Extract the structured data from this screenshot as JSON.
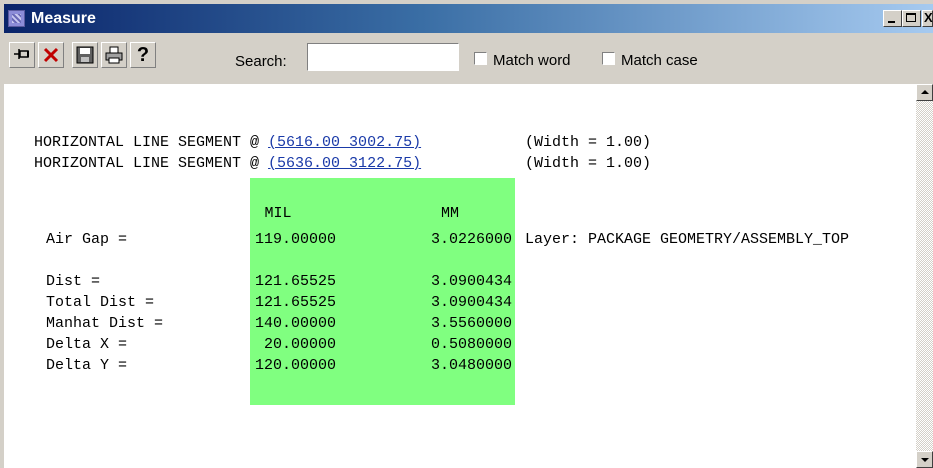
{
  "window": {
    "title": "Measure",
    "minimize_icon": "minimize-icon",
    "maximize_icon": "maximize-icon",
    "close_glyph": "X"
  },
  "toolbar": {
    "icons": [
      "pin-icon",
      "close-x-icon",
      "save-floppy-icon",
      "print-icon",
      "help-icon"
    ],
    "search_label": "Search:",
    "search_value": "",
    "match_word_label": "Match word",
    "match_case_label": "Match case",
    "match_word_checked": false,
    "match_case_checked": false
  },
  "report": {
    "segments": [
      {
        "prefix": "HORIZONTAL LINE SEGMENT @ ",
        "coord": "(5616.00 3002.75)",
        "suffix": "(Width = 1.00)"
      },
      {
        "prefix": "HORIZONTAL LINE SEGMENT @ ",
        "coord": "(5636.00 3122.75)",
        "suffix": "(Width = 1.00)"
      }
    ],
    "headers": {
      "mil": "MIL",
      "mm": "MM"
    },
    "air_gap": {
      "label": "Air Gap =",
      "mil": "119.00000",
      "mm": "3.0226000",
      "layer": "Layer: PACKAGE GEOMETRY/ASSEMBLY_TOP"
    },
    "rows": [
      {
        "label": "Dist =",
        "mil": "121.65525",
        "mm": "3.0900434"
      },
      {
        "label": "Total Dist =",
        "mil": "121.65525",
        "mm": "3.0900434"
      },
      {
        "label": "Manhat Dist =",
        "mil": "140.00000",
        "mm": "3.5560000"
      },
      {
        "label": "Delta X =",
        "mil": "20.00000",
        "mm": "0.5080000"
      },
      {
        "label": "Delta Y =",
        "mil": "120.00000",
        "mm": "3.0480000"
      }
    ],
    "highlight_color": "#80ff80",
    "link_color": "#1a3aa8"
  }
}
